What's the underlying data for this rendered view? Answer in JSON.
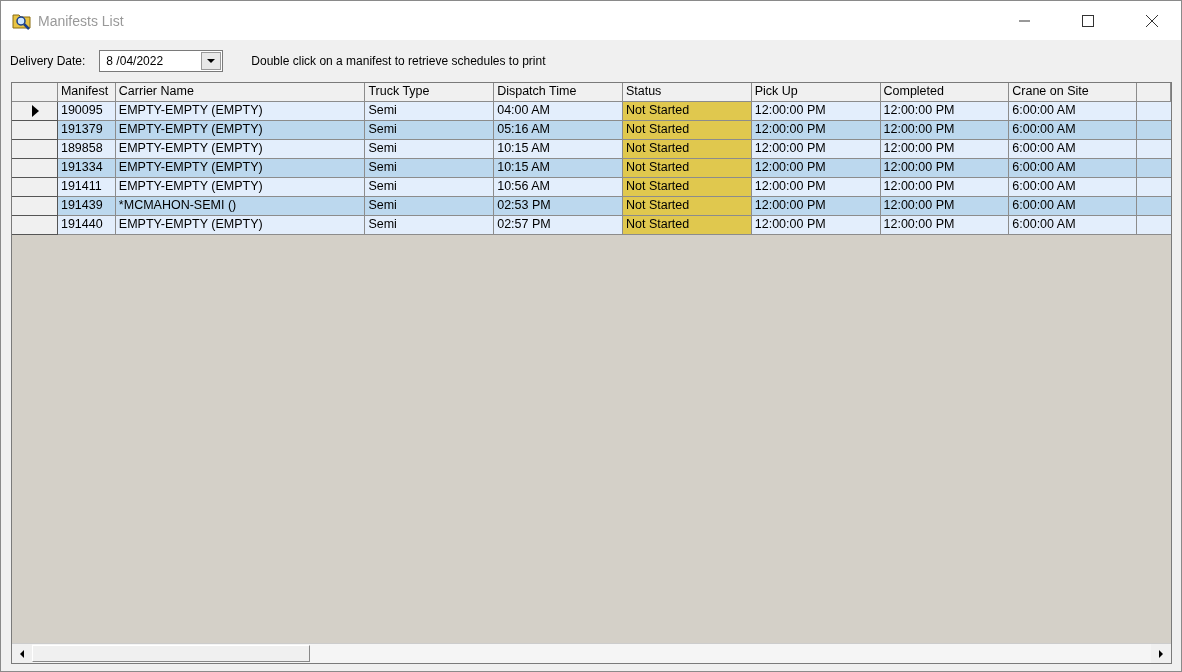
{
  "window": {
    "title": "Manifests List"
  },
  "filter": {
    "label": "Delivery Date:",
    "value": "8 /04/2022",
    "hint": "Double click on a manifest to retrieve schedules to print"
  },
  "table": {
    "columns": [
      "Manifest",
      "Carrier Name",
      "Truck Type",
      "Dispatch Time",
      "Status",
      "Pick Up",
      "Completed",
      "Crane on Site"
    ],
    "rows": [
      {
        "selected": true,
        "color": "#e0c84e",
        "cells": [
          "190095",
          "EMPTY-EMPTY (EMPTY)",
          "Semi",
          "04:00 AM",
          "Not Started",
          "12:00:00 PM",
          "12:00:00 PM",
          "6:00:00 AM"
        ]
      },
      {
        "selected": false,
        "color": "#e0c84e",
        "cells": [
          "191379",
          "EMPTY-EMPTY (EMPTY)",
          "Semi",
          "05:16 AM",
          "Not Started",
          "12:00:00 PM",
          "12:00:00 PM",
          "6:00:00 AM"
        ]
      },
      {
        "selected": false,
        "color": "#e0c84e",
        "cells": [
          "189858",
          "EMPTY-EMPTY (EMPTY)",
          "Semi",
          "10:15 AM",
          "Not Started",
          "12:00:00 PM",
          "12:00:00 PM",
          "6:00:00 AM"
        ]
      },
      {
        "selected": false,
        "color": "#e0c84e",
        "cells": [
          "191334",
          "EMPTY-EMPTY (EMPTY)",
          "Semi",
          "10:15 AM",
          "Not Started",
          "12:00:00 PM",
          "12:00:00 PM",
          "6:00:00 AM"
        ]
      },
      {
        "selected": false,
        "color": "#e0c84e",
        "cells": [
          "191411",
          "EMPTY-EMPTY (EMPTY)",
          "Semi",
          "10:56 AM",
          "Not Started",
          "12:00:00 PM",
          "12:00:00 PM",
          "6:00:00 AM"
        ]
      },
      {
        "selected": false,
        "color": "#e0c84e",
        "cells": [
          "191439",
          "*MCMAHON-SEMI ()",
          "Semi",
          "02:53 PM",
          "Not Started",
          "12:00:00 PM",
          "12:00:00 PM",
          "6:00:00 AM"
        ]
      },
      {
        "selected": false,
        "color": "#e0c84e",
        "cells": [
          "191440",
          "EMPTY-EMPTY (EMPTY)",
          "Semi",
          "02:57 PM",
          "Not Started",
          "12:00:00 PM",
          "12:00:00 PM",
          "6:00:00 AM"
        ]
      }
    ]
  }
}
